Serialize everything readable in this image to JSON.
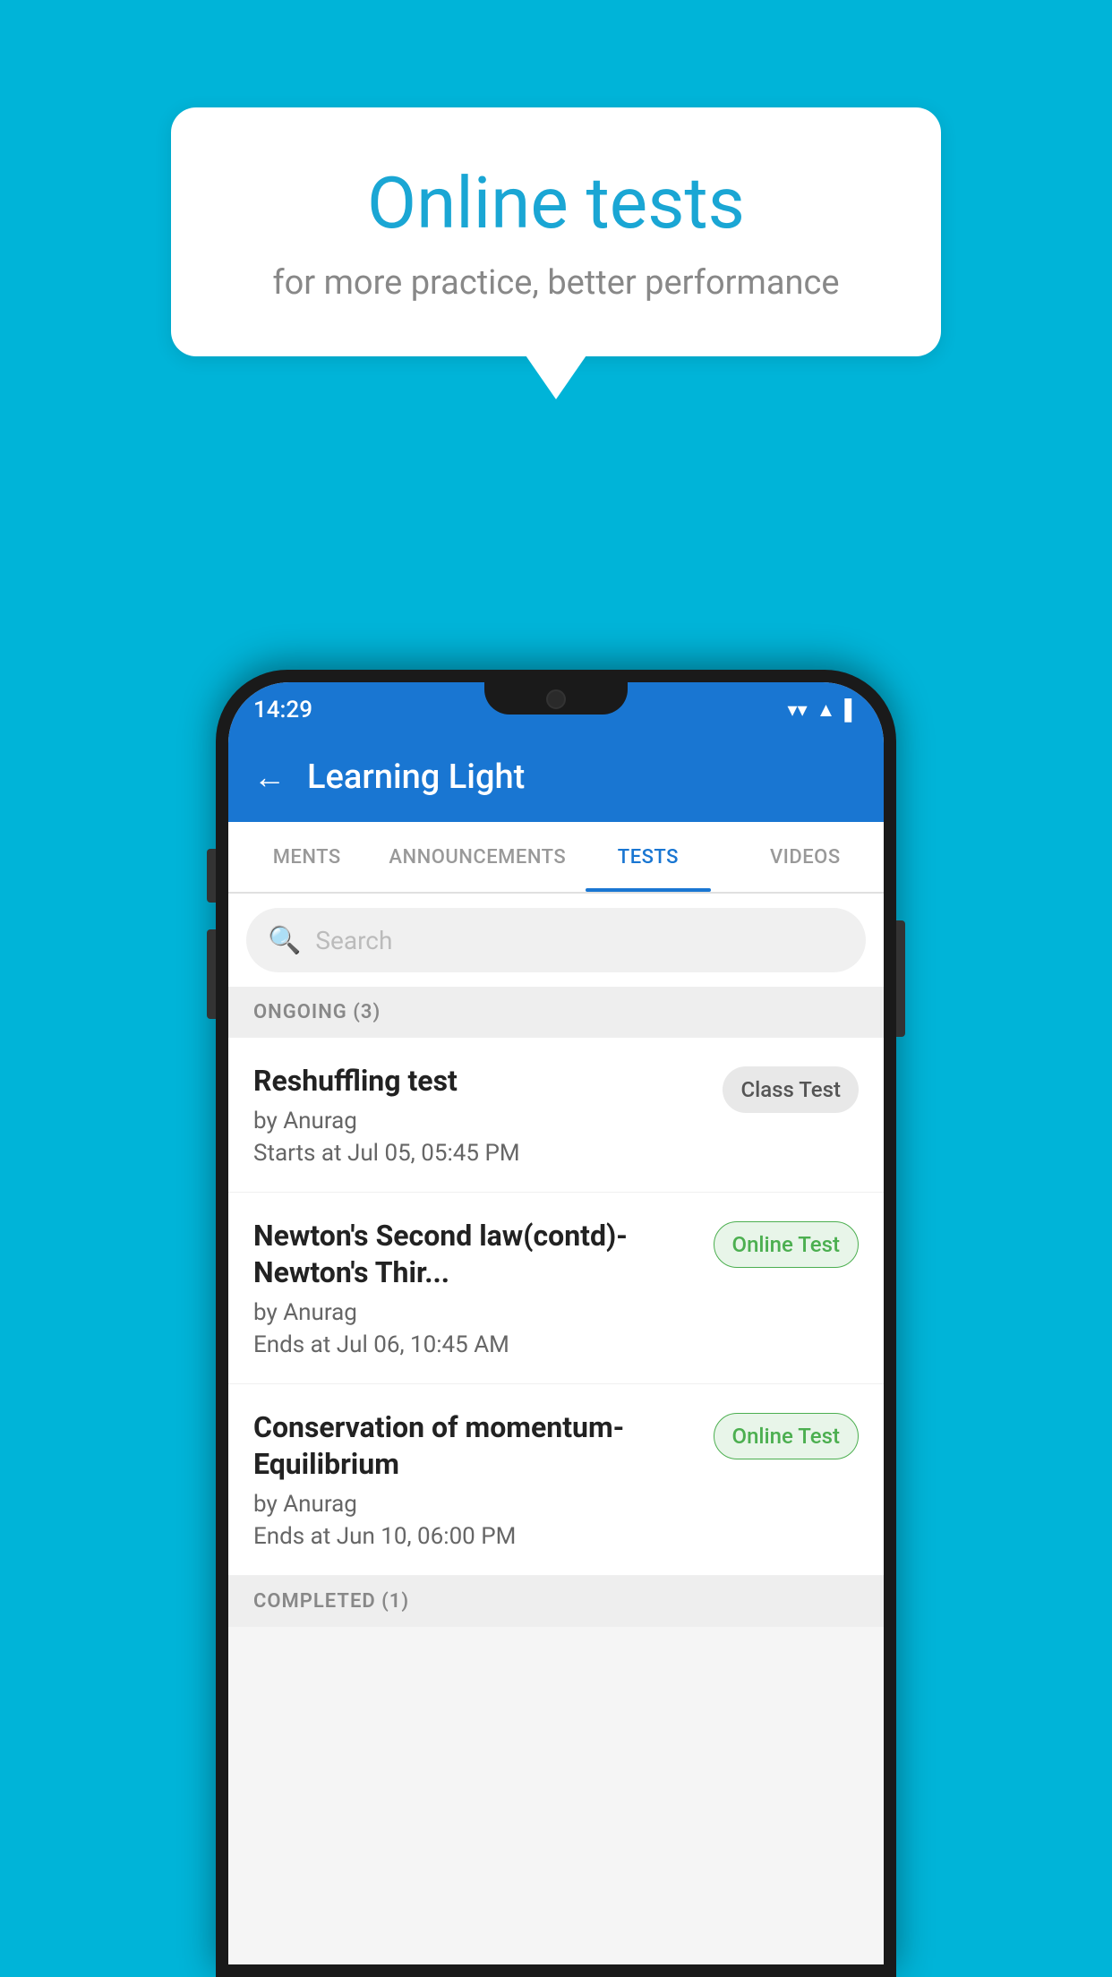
{
  "background_color": "#00b4d8",
  "speech_bubble": {
    "title": "Online tests",
    "subtitle": "for more practice, better performance"
  },
  "phone": {
    "status_bar": {
      "time": "14:29",
      "wifi": "▼",
      "signal": "▲",
      "battery": "▌"
    },
    "app_bar": {
      "back_label": "←",
      "title": "Learning Light"
    },
    "tabs": [
      {
        "label": "MENTS",
        "active": false
      },
      {
        "label": "ANNOUNCEMENTS",
        "active": false
      },
      {
        "label": "TESTS",
        "active": true
      },
      {
        "label": "VIDEOS",
        "active": false
      }
    ],
    "search": {
      "placeholder": "Search"
    },
    "sections": [
      {
        "header": "ONGOING (3)",
        "tests": [
          {
            "title": "Reshuffling test",
            "author": "by Anurag",
            "date": "Starts at  Jul 05, 05:45 PM",
            "badge_label": "Class Test",
            "badge_type": "class"
          },
          {
            "title": "Newton's Second law(contd)-Newton's Thir...",
            "author": "by Anurag",
            "date": "Ends at  Jul 06, 10:45 AM",
            "badge_label": "Online Test",
            "badge_type": "online"
          },
          {
            "title": "Conservation of momentum-Equilibrium",
            "author": "by Anurag",
            "date": "Ends at  Jun 10, 06:00 PM",
            "badge_label": "Online Test",
            "badge_type": "online"
          }
        ]
      },
      {
        "header": "COMPLETED (1)",
        "tests": []
      }
    ]
  }
}
